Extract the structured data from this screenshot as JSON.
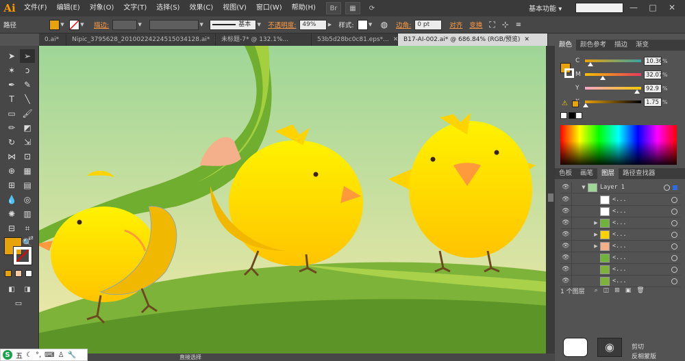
{
  "app": {
    "logo": "Ai"
  },
  "menus": [
    "文件(F)",
    "编辑(E)",
    "对象(O)",
    "文字(T)",
    "选择(S)",
    "效果(C)",
    "视图(V)",
    "窗口(W)",
    "帮助(H)"
  ],
  "menubar_icons": {
    "br": "Br",
    "arrange": "arrange-docs-icon",
    "sync": "sync-icon"
  },
  "workspace": {
    "label": "基本功能",
    "chevron": "▾"
  },
  "search": {
    "placeholder": ""
  },
  "window": {
    "minimize": "—",
    "maximize": "□",
    "close": "✕"
  },
  "control": {
    "selection_label": "路径",
    "stroke_label": "描边:",
    "stroke_profile": "基本",
    "opacity_label": "不透明度:",
    "opacity_value": "49%",
    "style_label": "样式:",
    "corner_label": "边角:",
    "corner_value": "0 pt",
    "align_label": "对齐",
    "transform_label": "变换"
  },
  "tabs": [
    {
      "label": "0.ai*",
      "active": false
    },
    {
      "label": "Nipic_3795628_20100224224515034128.ai*",
      "active": false
    },
    {
      "label": "未标题-7* @ 132.1%...",
      "active": false
    },
    {
      "label": "53b5d28bc0c81.eps*...",
      "active": false
    },
    {
      "label": "B17-AI-002.ai* @ 686.84% (RGB/预览)",
      "active": true
    }
  ],
  "colors": {
    "fill": "#e8a20a",
    "accent": "#ff9c43",
    "cmyk_result": "#e8a20a",
    "sky_top": "#9ed697",
    "sky_bottom": "#f3e9a8",
    "grass": "#7eb33a",
    "chick": "#ffd300",
    "beak": "#ff9a3c"
  },
  "color_panel": {
    "tabs": [
      "颜色",
      "颜色参考",
      "描边",
      "渐变"
    ],
    "sliders": [
      {
        "letter": "C",
        "value": "10.36",
        "fraction": 0.1036,
        "gradient": "linear-gradient(to right,#e8a20a,#3aa2a0)"
      },
      {
        "letter": "M",
        "value": "32.07",
        "fraction": 0.3207,
        "gradient": "linear-gradient(to right,#f5c000,#e83a5e)"
      },
      {
        "letter": "Y",
        "value": "92.9",
        "fraction": 0.929,
        "gradient": "linear-gradient(to right,#f4a6c8,#f3c800)"
      },
      {
        "letter": "K",
        "value": "1.75",
        "fraction": 0.0175,
        "gradient": "linear-gradient(to right,#e8a20a,#000000)"
      }
    ],
    "unit": "%"
  },
  "layers_panel": {
    "tabs": [
      "色板",
      "画笔",
      "图层",
      "路径查找器"
    ],
    "layer_name": "Layer 1",
    "sublayer_label": "<...",
    "footer_count": "1 个图层",
    "rows": [
      {
        "thumb": "#ffffff",
        "expand": false
      },
      {
        "thumb": "#ffffff",
        "expand": false
      },
      {
        "thumb": "#6fb33a",
        "expand": true
      },
      {
        "thumb": "#ffd300",
        "expand": true
      },
      {
        "thumb": "#f4b08a",
        "expand": true
      },
      {
        "thumb": "#6fb33a",
        "expand": false
      },
      {
        "thumb": "#7eb33a",
        "expand": false
      },
      {
        "thumb": "#7eb33a",
        "expand": false
      }
    ]
  },
  "statusbar": {
    "tool_label": "直接选择"
  },
  "bottom_options": {
    "cut": "剪切",
    "invert_mask": "反相蒙版"
  },
  "ime": {
    "logo": "S",
    "mode": "五"
  }
}
